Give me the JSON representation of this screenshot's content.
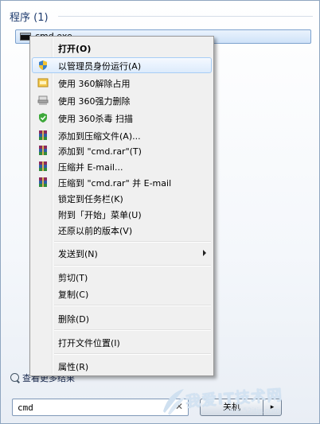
{
  "start_menu": {
    "section_header": "程序 (1)",
    "result": {
      "label": "cmd.exe",
      "icon": "command-prompt-icon"
    },
    "more_results_label": "查看更多结果",
    "search": {
      "value": "cmd"
    },
    "shutdown_label": "关机",
    "shutdown_arrow": "▸"
  },
  "context_menu": {
    "items": [
      {
        "label": "打开(O)",
        "bold": true,
        "icon": ""
      },
      {
        "label": "以管理员身份运行(A)",
        "icon": "uac-shield-icon",
        "hover": true
      },
      {
        "label": "使用 360解除占用",
        "icon": "360-unlock-icon"
      },
      {
        "label": "使用 360强力删除",
        "icon": "360-shred-icon"
      },
      {
        "label": "使用 360杀毒 扫描",
        "icon": "360-antivirus-icon"
      },
      {
        "label": "添加到压缩文件(A)...",
        "icon": "winrar-icon"
      },
      {
        "label": "添加到 \"cmd.rar\"(T)",
        "icon": "winrar-icon"
      },
      {
        "label": "压缩并 E-mail...",
        "icon": "winrar-icon"
      },
      {
        "label": "压缩到 \"cmd.rar\" 并 E-mail",
        "icon": "winrar-icon"
      },
      {
        "label": "锁定到任务栏(K)"
      },
      {
        "label": "附到「开始」菜单(U)"
      },
      {
        "label": "还原以前的版本(V)"
      },
      {
        "label": "发送到(N)",
        "submenu": true
      },
      {
        "label": "剪切(T)"
      },
      {
        "label": "复制(C)"
      },
      {
        "label": "删除(D)"
      },
      {
        "label": "打开文件位置(I)"
      },
      {
        "label": "属性(R)"
      }
    ]
  },
  "watermark": {
    "text": "我爱IT技术网",
    "url": "www.52itjs.com",
    "logo": "watermark-logo"
  },
  "colors": {
    "hover_bg": "#dcebfc",
    "hover_border": "#a7cdf5",
    "header_text": "#1e3b6e"
  }
}
